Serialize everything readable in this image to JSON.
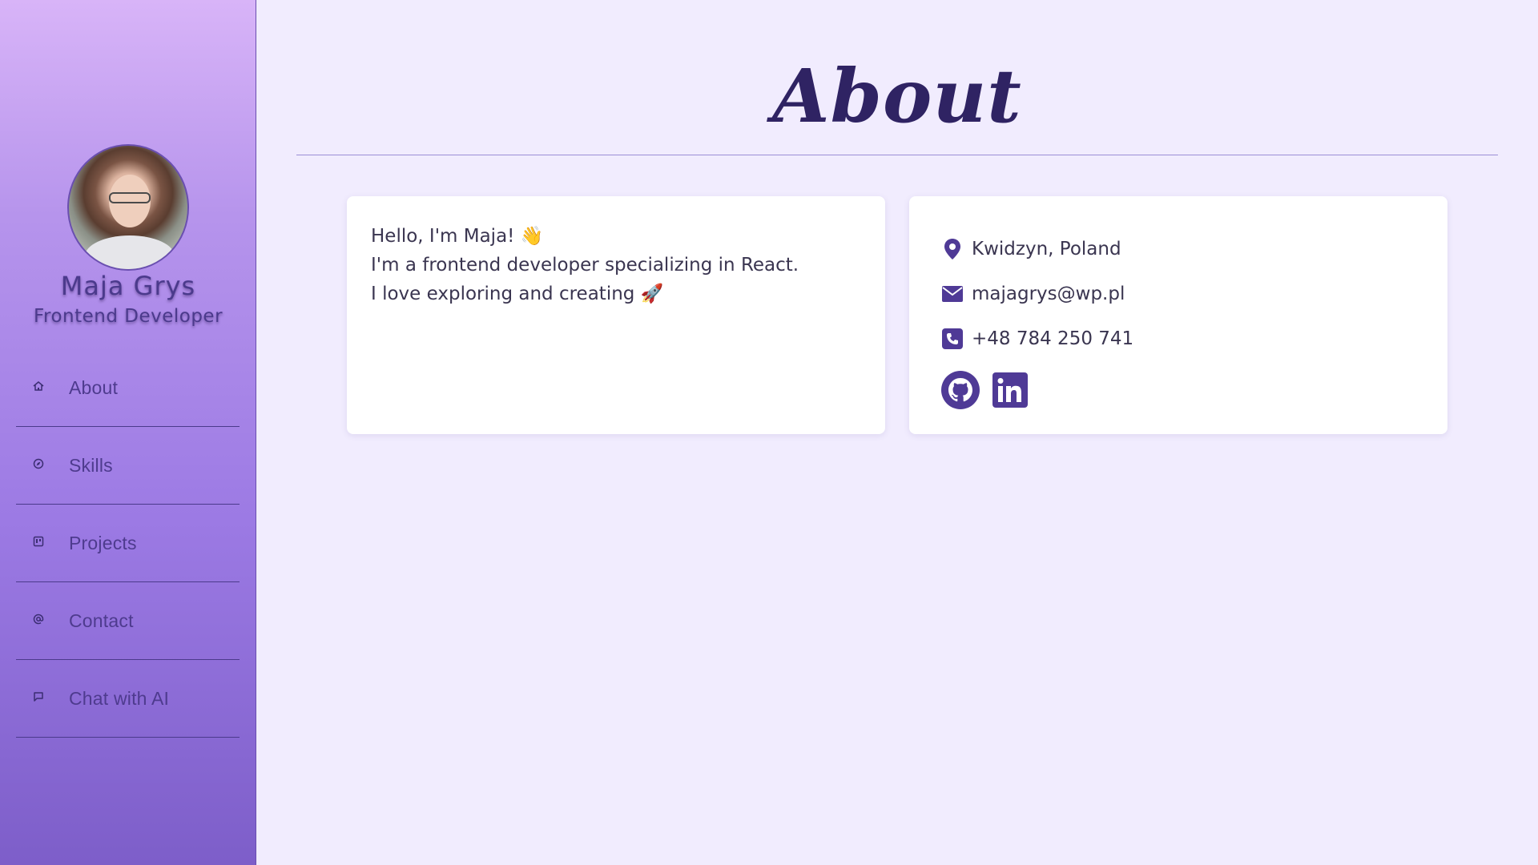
{
  "sidebar": {
    "name": "Maja Grys",
    "role": "Frontend Developer",
    "items": [
      {
        "label": "About",
        "icon": "home-icon"
      },
      {
        "label": "Skills",
        "icon": "compass-icon"
      },
      {
        "label": "Projects",
        "icon": "kanban-icon"
      },
      {
        "label": "Contact",
        "icon": "at-sign-icon"
      },
      {
        "label": "Chat with AI",
        "icon": "chat-icon"
      }
    ]
  },
  "main": {
    "title": "About",
    "intro": {
      "line1": "Hello, I'm Maja! 👋",
      "line2": "I'm a frontend developer specializing in React.",
      "line3": "I love exploring and creating 🚀"
    },
    "contact": {
      "location": "Kwidzyn, Poland",
      "email": "majagrys@wp.pl",
      "phone": "+48 784 250 741",
      "socials": [
        "github-icon",
        "linkedin-icon"
      ]
    }
  },
  "colors": {
    "accent": "#4f3a96",
    "background": "#f1ecfe",
    "sidebar_top": "#d8b4f8",
    "sidebar_bottom": "#7d5ec9"
  }
}
